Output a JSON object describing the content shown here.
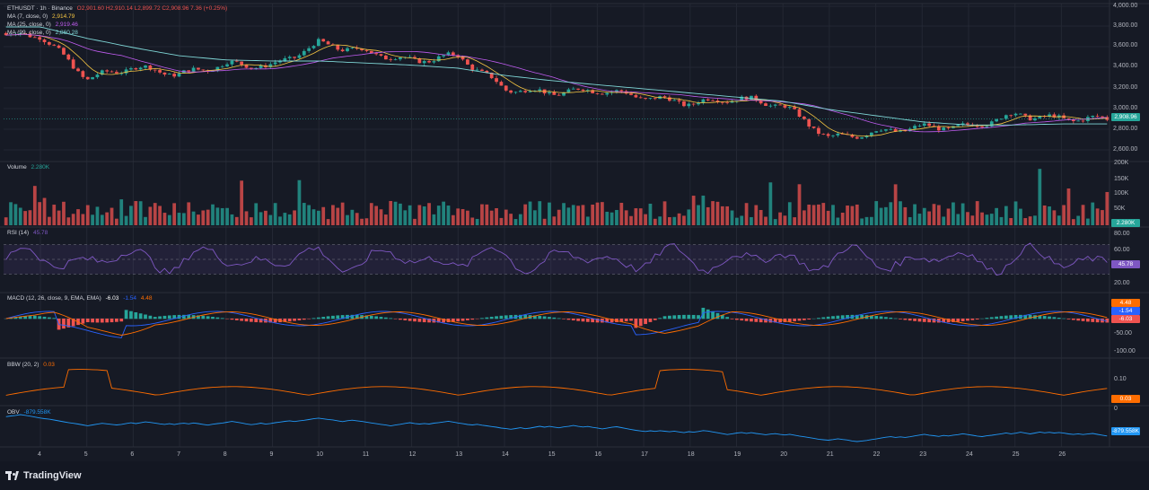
{
  "header": {
    "symbol": "ETHUSDT · 1h · Binance",
    "ohlc": "O2,901.60  H2,910.14  L2,899.72  C2,908.96  7.36 (+0.25%)"
  },
  "overlays": [
    {
      "name": "MA (7, close, 0)",
      "value": "2,914.79",
      "color": "#f5c542"
    },
    {
      "name": "MA (25, close, 0)",
      "value": "2,919.46",
      "color": "#c05cf0"
    },
    {
      "name": "MA (99, close, 0)",
      "value": "2,860.28",
      "color": "#7fd6d6"
    }
  ],
  "price_ticks": [
    "4,000.00",
    "3,800.00",
    "3,600.00",
    "3,400.00",
    "3,200.00",
    "3,000.00",
    "2,800.00",
    "2,600.00"
  ],
  "last_price": "2,908.96",
  "volume": {
    "label": "Volume",
    "value": "2.280K",
    "ticks": [
      "200K",
      "150K",
      "100K",
      "50K"
    ]
  },
  "rsi": {
    "label": "RSI (14)",
    "value": "45.78",
    "ticks": [
      "80.00",
      "60.00",
      "40.00",
      "20.00"
    ]
  },
  "macd": {
    "label": "MACD (12, 26, close, 9, EMA, EMA)",
    "hist": "-6.03",
    "macd": "-1.54",
    "signal": "4.48",
    "ticks": [
      "0.00",
      "-50.00",
      "-100.00"
    ]
  },
  "bbw": {
    "label": "BBW (20, 2)",
    "value": "0.03",
    "ticks": [
      "0.10"
    ]
  },
  "obv": {
    "label": "OBV",
    "value": "-879.558K",
    "ticks": [
      "0"
    ]
  },
  "x_ticks": [
    "4",
    "5",
    "6",
    "7",
    "8",
    "9",
    "10",
    "11",
    "12",
    "13",
    "14",
    "15",
    "16",
    "17",
    "18",
    "19",
    "20",
    "21",
    "22",
    "23",
    "24",
    "25",
    "26"
  ],
  "brand": "TradingView",
  "colors": {
    "up": "#26a69a",
    "down": "#ef5350",
    "rsi": "#7e57c2",
    "macd": "#2962ff",
    "signal": "#ff6d00",
    "bbw": "#ff6d00",
    "obv": "#2196f3",
    "grid": "#232733",
    "bg": "#161a25"
  },
  "chart_data": {
    "type": "line",
    "title": "ETHUSDT · 1h · Binance",
    "x": [
      "4",
      "5",
      "6",
      "7",
      "8",
      "9",
      "10",
      "11",
      "12",
      "13",
      "14",
      "15",
      "16",
      "17",
      "18",
      "19",
      "20",
      "21",
      "22",
      "23",
      "24",
      "25",
      "26"
    ],
    "ylim": [
      2600,
      4000
    ],
    "series": [
      {
        "name": "close",
        "values": [
          3720,
          3300,
          3410,
          3340,
          3440,
          3420,
          3640,
          3560,
          3470,
          3520,
          3200,
          3160,
          3190,
          3120,
          3060,
          3110,
          3040,
          2720,
          2780,
          2830,
          2830,
          2950,
          2909
        ]
      },
      {
        "name": "MA (99, close, 0)",
        "values": [
          3800,
          3690,
          3600,
          3520,
          3480,
          3470,
          3470,
          3450,
          3430,
          3400,
          3330,
          3280,
          3240,
          3200,
          3160,
          3120,
          3080,
          3000,
          2940,
          2880,
          2850,
          2850,
          2860
        ]
      }
    ]
  }
}
